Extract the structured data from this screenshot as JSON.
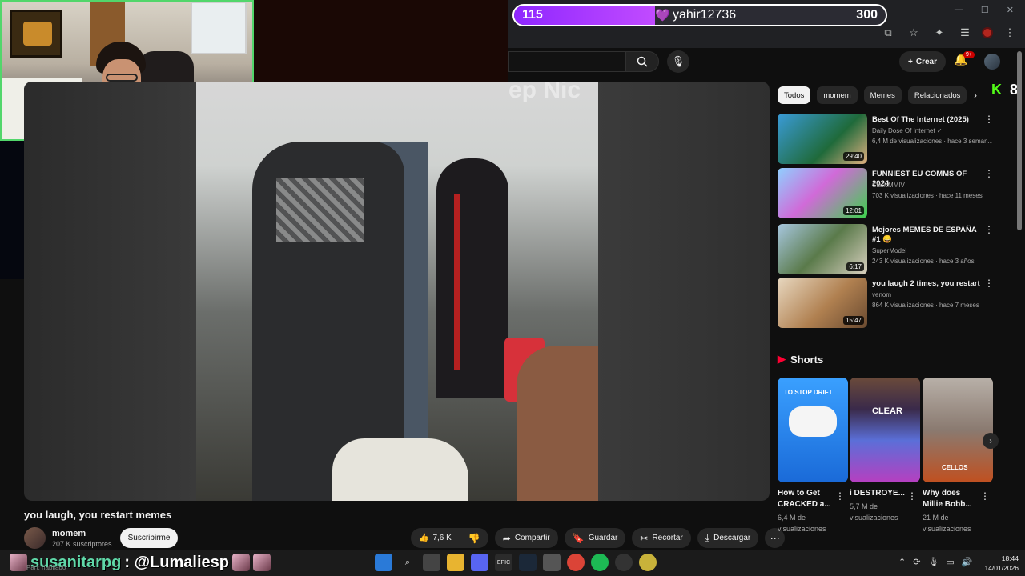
{
  "window": {
    "minimize": "—",
    "maximize": "☐",
    "close": "✕"
  },
  "points_overlay": {
    "left_points": "115",
    "fill_fraction": 0.38,
    "username": "yahir12736",
    "right_points": "300"
  },
  "yt_header": {
    "create_label": "Crear",
    "notification_badge": "9+"
  },
  "player": {
    "overlay_text": "ep Nic"
  },
  "video": {
    "title": "you laugh, you restart memes",
    "channel": "momem",
    "subscribers": "207 K suscriptores",
    "subscribe_label": "Suscribirme",
    "likes": "7,6 K",
    "share_label": "Compartir",
    "save_label": "Guardar",
    "clip_label": "Recortar",
    "download_label": "Descargar"
  },
  "chips": [
    "Todos",
    "momem",
    "Memes",
    "Relacionados"
  ],
  "kick": {
    "logo": "K",
    "count": "8"
  },
  "recommendations": [
    {
      "title": "Best Of The Internet (2025)",
      "channel": "Daily Dose Of Internet ✓",
      "meta": "6,4 M de visualizaciones · hace 3 seman...",
      "duration": "29:40"
    },
    {
      "title": "FUNNIEST EU COMMS OF 2024",
      "channel": "StaticMMIV",
      "meta": "703 K visualizaciones · hace 11 meses",
      "duration": "12:01"
    },
    {
      "title": "Mejores MEMES DE ESPAÑA #1 😄",
      "channel": "SuperModel",
      "meta": "243 K visualizaciones · hace 3 años",
      "duration": "6:17"
    },
    {
      "title": "you laugh 2 times, you restart",
      "channel": "venom",
      "meta": "864 K visualizaciones · hace 7 meses",
      "duration": "15:47"
    }
  ],
  "shorts": {
    "header": "Shorts",
    "items": [
      {
        "title": "How to Get CRACKED a...",
        "views": "6,4 M de visualizaciones",
        "overlay": "TO STOP DRIFT"
      },
      {
        "title": "i DESTROYE...",
        "views": "5,7 M de visualizaciones",
        "overlay": "CLEAR"
      },
      {
        "title": "Why does Millie Bobb...",
        "views": "21 M de visualizaciones",
        "overlay": "CELLOS"
      }
    ]
  },
  "chat": {
    "user": "susanitarpg",
    "message": ": @Lumaliesp",
    "sub": "Part: habilado"
  },
  "clock": {
    "time": "18:44",
    "date": "14/01/2026"
  }
}
